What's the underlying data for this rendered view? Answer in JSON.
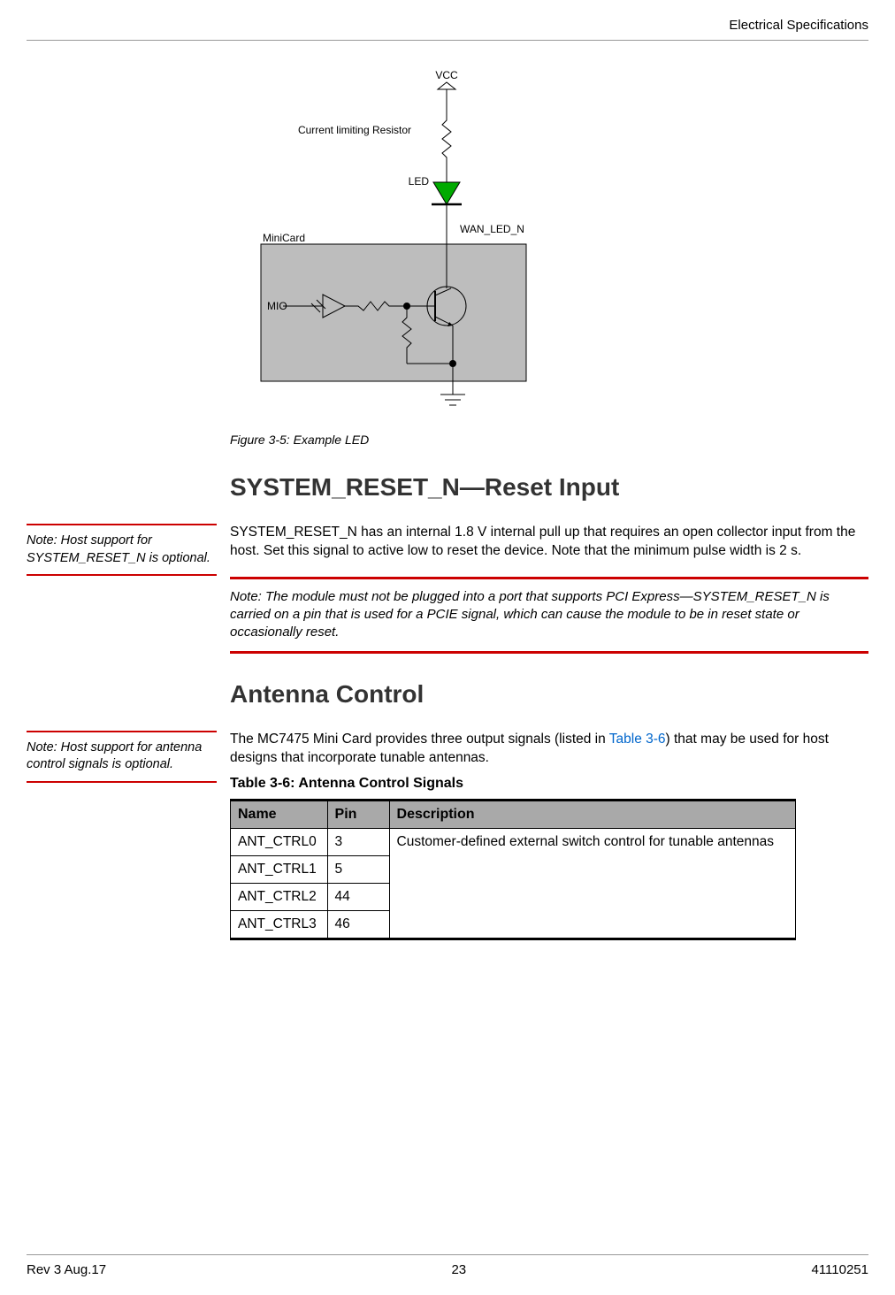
{
  "header": {
    "section_title": "Electrical Specifications"
  },
  "figure": {
    "labels": {
      "vcc": "VCC",
      "resistor": "Current limiting Resistor",
      "led": "LED",
      "wan_led_n": "WAN_LED_N",
      "minicard": "MiniCard",
      "mio": "MIO"
    },
    "caption": "Figure 3-5:  Example LED"
  },
  "section1": {
    "heading": "SYSTEM_RESET_N—Reset Input",
    "side_note": "Note:  Host support for SYSTEM_RESET_N is optional.",
    "body": "SYSTEM_RESET_N has an internal 1.8 V internal pull up that requires an open collector input from the host. Set this signal to active low to reset the device. Note that the minimum pulse width is 2 s.",
    "warn": "Note:  The module must not be plugged into a port that supports PCI Express—SYSTEM_RESET_N is carried on a pin that is used for a PCIE signal, which can cause the module to be in reset state or occasionally reset."
  },
  "section2": {
    "heading": "Antenna Control",
    "side_note": "Note:  Host support for antenna control signals is optional.",
    "body_pre": "The MC7475 Mini Card provides three output signals (listed in ",
    "body_link": "Table 3-6",
    "body_post": ") that may be used for host designs that incorporate tunable antennas.",
    "table_title": "Table 3-6:  Antenna Control Signals",
    "table": {
      "headers": [
        "Name",
        "Pin",
        "Description"
      ],
      "rows": [
        {
          "name": "ANT_CTRL0",
          "pin": "3"
        },
        {
          "name": "ANT_CTRL1",
          "pin": "5"
        },
        {
          "name": "ANT_CTRL2",
          "pin": "44"
        },
        {
          "name": "ANT_CTRL3",
          "pin": "46"
        }
      ],
      "desc": "Customer-defined external switch control for tunable antennas"
    }
  },
  "footer": {
    "rev": "Rev 3  Aug.17",
    "page": "23",
    "docnum": "41110251"
  }
}
